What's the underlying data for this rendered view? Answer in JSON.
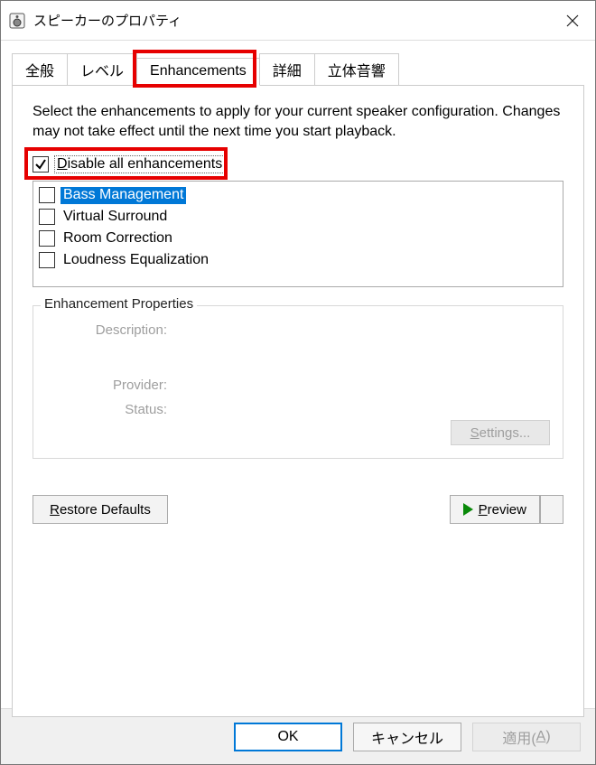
{
  "window": {
    "title": "スピーカーのプロパティ",
    "icon": "speaker-icon"
  },
  "tabs": [
    {
      "label": "全般",
      "active": false
    },
    {
      "label": "レベル",
      "active": false
    },
    {
      "label": "Enhancements",
      "active": true
    },
    {
      "label": "詳細",
      "active": false
    },
    {
      "label": "立体音響",
      "active": false
    }
  ],
  "highlighted_tab_index": 2,
  "body": {
    "instruction": "Select the enhancements to apply for your current speaker configuration. Changes may not take effect until the next time you start playback.",
    "disable_all": {
      "prefix": "D",
      "rest": "isable all enhancements",
      "checked": true,
      "highlighted": true
    },
    "enhancements": [
      {
        "label": "Bass Management",
        "checked": false,
        "selected": true
      },
      {
        "label": "Virtual Surround",
        "checked": false,
        "selected": false
      },
      {
        "label": "Room Correction",
        "checked": false,
        "selected": false
      },
      {
        "label": "Loudness Equalization",
        "checked": false,
        "selected": false
      }
    ],
    "group": {
      "legend": "Enhancement Properties",
      "description_label": "Description:",
      "provider_label": "Provider:",
      "status_label": "Status:",
      "settings_prefix": "S",
      "settings_rest": "ettings...",
      "settings_enabled": false
    },
    "restore_prefix": "R",
    "restore_rest": "estore Defaults",
    "preview_prefix": "P",
    "preview_rest": "review"
  },
  "footer": {
    "ok": "OK",
    "cancel": "キャンセル",
    "apply_label": "適用(",
    "apply_ul": "A",
    "apply_tail": ")",
    "apply_enabled": false
  }
}
